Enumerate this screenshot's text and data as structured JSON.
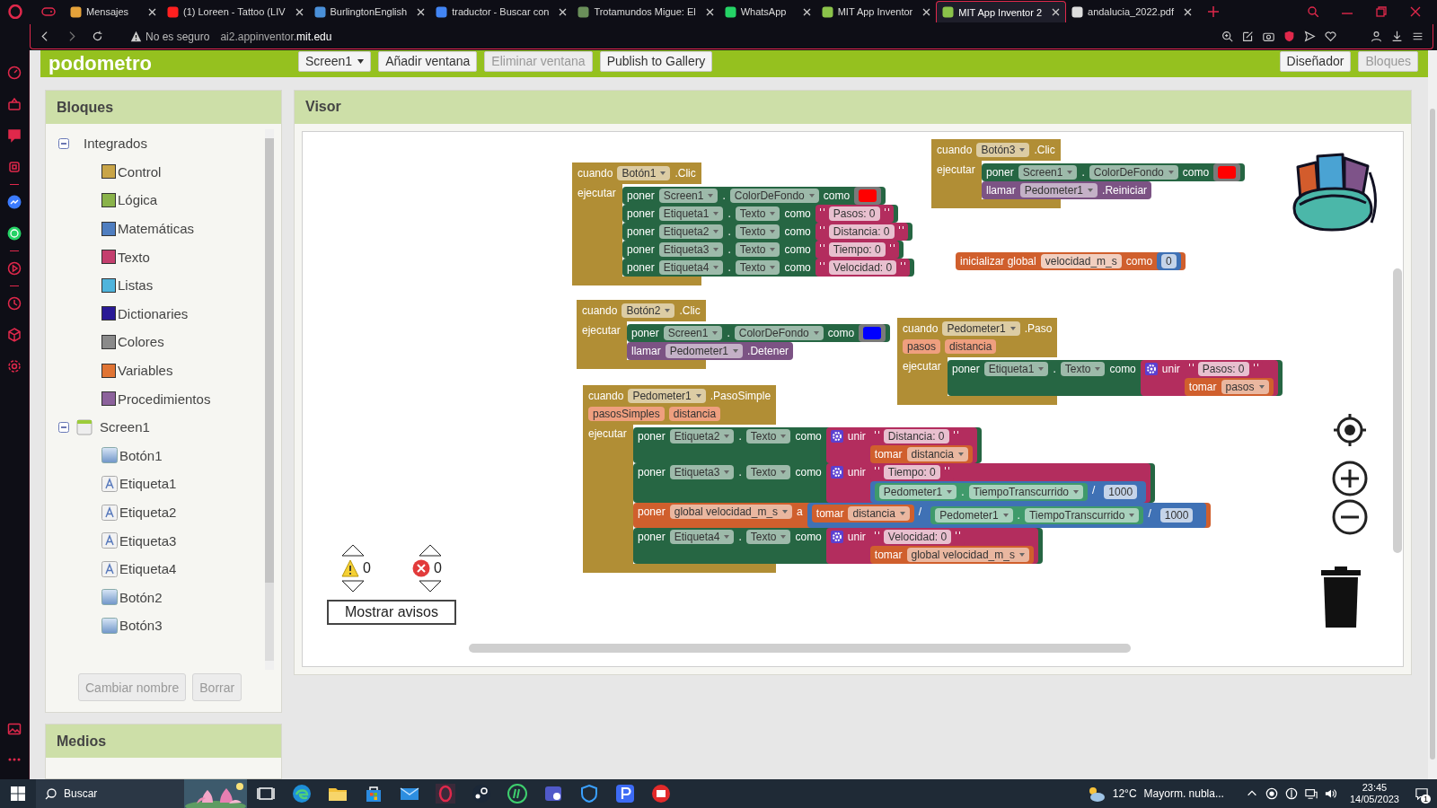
{
  "browser": {
    "tabs": [
      {
        "title": "Mensajes",
        "selected": false
      },
      {
        "title": "(1) Loreen - Tattoo (LIV",
        "selected": false
      },
      {
        "title": "BurlingtonEnglish",
        "selected": false
      },
      {
        "title": "traductor - Buscar con",
        "selected": false
      },
      {
        "title": "Trotamundos Migue: El",
        "selected": false
      },
      {
        "title": "WhatsApp",
        "selected": false
      },
      {
        "title": "MIT App Inventor",
        "selected": false
      },
      {
        "title": "MIT App Inventor 2",
        "selected": true
      },
      {
        "title": "andalucia_2022.pdf",
        "selected": false
      }
    ],
    "security": "No es seguro",
    "url": "ai2.appinventor.**mit.edu**"
  },
  "app": {
    "title": "podometro",
    "toolbar": [
      {
        "label": "Screen1",
        "kind": "dropdown",
        "disabled": false
      },
      {
        "label": "Añadir ventana",
        "kind": "button",
        "disabled": false
      },
      {
        "label": "Eliminar ventana",
        "kind": "button",
        "disabled": true
      },
      {
        "label": "Publish to Gallery",
        "kind": "button",
        "disabled": false
      }
    ],
    "views": [
      {
        "label": "Diseñador",
        "selected": false
      },
      {
        "label": "Bloques",
        "selected": true
      }
    ]
  },
  "blocks_panel": {
    "title": "Bloques",
    "tree": [
      {
        "label": "Integrados",
        "kind": "group",
        "expanded": true,
        "children": [
          {
            "label": "Control",
            "color": "#c9a548"
          },
          {
            "label": "Lógica",
            "color": "#8ab34a"
          },
          {
            "label": "Matemáticas",
            "color": "#4f7ec0"
          },
          {
            "label": "Texto",
            "color": "#c43f6e"
          },
          {
            "label": "Listas",
            "color": "#4fb4dc"
          },
          {
            "label": "Dictionaries",
            "color": "#2a1a96"
          },
          {
            "label": "Colores",
            "color": "#8a8a8a"
          },
          {
            "label": "Variables",
            "color": "#e07434"
          },
          {
            "label": "Procedimientos",
            "color": "#8c629c"
          }
        ]
      },
      {
        "label": "Screen1",
        "kind": "screen",
        "expanded": true,
        "children": [
          {
            "label": "Botón1",
            "kind": "button"
          },
          {
            "label": "Etiqueta1",
            "kind": "label"
          },
          {
            "label": "Etiqueta2",
            "kind": "label"
          },
          {
            "label": "Etiqueta3",
            "kind": "label"
          },
          {
            "label": "Etiqueta4",
            "kind": "label"
          },
          {
            "label": "Botón2",
            "kind": "button"
          },
          {
            "label": "Botón3",
            "kind": "button"
          }
        ]
      }
    ],
    "buttons": [
      {
        "label": "Cambiar nombre",
        "disabled": true
      },
      {
        "label": "Borrar",
        "disabled": true
      }
    ]
  },
  "media_panel": {
    "title": "Medios"
  },
  "viewer": {
    "title": "Visor",
    "warnings": "0",
    "errors": "0",
    "warnings_button": "Mostrar avisos",
    "blocks": [
      {
        "kind": "control",
        "rows": [
          [
            {
              "kind": "label",
              "text": "cuando"
            },
            {
              "kind": "dropdown",
              "text": "Botón1"
            },
            {
              "kind": "label",
              "text": ".Clic"
            }
          ],
          [
            {
              "kind": "label",
              "text": "ejecutar"
            },
            {
              "kind": "stack",
              "blocks": [
                {
                  "kind": "setter",
                  "rows": [
                    [
                      {
                        "kind": "label",
                        "text": "poner"
                      },
                      {
                        "kind": "dropdown",
                        "text": "Screen1"
                      },
                      {
                        "kind": "label",
                        "text": "."
                      },
                      {
                        "kind": "dropdown",
                        "text": "ColorDeFondo"
                      },
                      {
                        "kind": "label",
                        "text": "como"
                      },
                      {
                        "kind": "value",
                        "block": {
                          "kind": "color",
                          "rows": [
                            [
                              {
                                "kind": "swatch",
                                "color": "#ff0000"
                              }
                            ]
                          ]
                        }
                      }
                    ]
                  ]
                },
                {
                  "kind": "setter",
                  "rows": [
                    [
                      {
                        "kind": "label",
                        "text": "poner"
                      },
                      {
                        "kind": "dropdown",
                        "text": "Etiqueta1"
                      },
                      {
                        "kind": "label",
                        "text": "."
                      },
                      {
                        "kind": "dropdown",
                        "text": "Texto"
                      },
                      {
                        "kind": "label",
                        "text": "como"
                      },
                      {
                        "kind": "value",
                        "block": {
                          "kind": "text",
                          "rows": [
                            [
                              {
                                "kind": "quote",
                                "text": "Pasos: 0"
                              }
                            ]
                          ]
                        }
                      }
                    ]
                  ]
                },
                {
                  "kind": "setter",
                  "rows": [
                    [
                      {
                        "kind": "label",
                        "text": "poner"
                      },
                      {
                        "kind": "dropdown",
                        "text": "Etiqueta2"
                      },
                      {
                        "kind": "label",
                        "text": "."
                      },
                      {
                        "kind": "dropdown",
                        "text": "Texto"
                      },
                      {
                        "kind": "label",
                        "text": "como"
                      },
                      {
                        "kind": "value",
                        "block": {
                          "kind": "text",
                          "rows": [
                            [
                              {
                                "kind": "quote",
                                "text": "Distancia: 0"
                              }
                            ]
                          ]
                        }
                      }
                    ]
                  ]
                },
                {
                  "kind": "setter",
                  "rows": [
                    [
                      {
                        "kind": "label",
                        "text": "poner"
                      },
                      {
                        "kind": "dropdown",
                        "text": "Etiqueta3"
                      },
                      {
                        "kind": "label",
                        "text": "."
                      },
                      {
                        "kind": "dropdown",
                        "text": "Texto"
                      },
                      {
                        "kind": "label",
                        "text": "como"
                      },
                      {
                        "kind": "value",
                        "block": {
                          "kind": "text",
                          "rows": [
                            [
                              {
                                "kind": "quote",
                                "text": "Tiempo: 0"
                              }
                            ]
                          ]
                        }
                      }
                    ]
                  ]
                },
                {
                  "kind": "setter",
                  "rows": [
                    [
                      {
                        "kind": "label",
                        "text": "poner"
                      },
                      {
                        "kind": "dropdown",
                        "text": "Etiqueta4"
                      },
                      {
                        "kind": "label",
                        "text": "."
                      },
                      {
                        "kind": "dropdown",
                        "text": "Texto"
                      },
                      {
                        "kind": "label",
                        "text": "como"
                      },
                      {
                        "kind": "value",
                        "block": {
                          "kind": "text",
                          "rows": [
                            [
                              {
                                "kind": "quote",
                                "text": "Velocidad: 0"
                              }
                            ]
                          ]
                        }
                      }
                    ]
                  ]
                }
              ]
            }
          ]
        ]
      },
      {
        "kind": "control",
        "rows": [
          [
            {
              "kind": "label",
              "text": "cuando"
            },
            {
              "kind": "dropdown",
              "text": "Botón3"
            },
            {
              "kind": "label",
              "text": ".Clic"
            }
          ],
          [
            {
              "kind": "label",
              "text": "ejecutar"
            },
            {
              "kind": "stack",
              "blocks": [
                {
                  "kind": "setter",
                  "rows": [
                    [
                      {
                        "kind": "label",
                        "text": "poner"
                      },
                      {
                        "kind": "dropdown",
                        "text": "Screen1"
                      },
                      {
                        "kind": "label",
                        "text": "."
                      },
                      {
                        "kind": "dropdown",
                        "text": "ColorDeFondo"
                      },
                      {
                        "kind": "label",
                        "text": "como"
                      },
                      {
                        "kind": "value",
                        "block": {
                          "kind": "color",
                          "rows": [
                            [
                              {
                                "kind": "swatch",
                                "color": "#ff0000"
                              }
                            ]
                          ]
                        }
                      }
                    ]
                  ]
                },
                {
                  "kind": "call",
                  "rows": [
                    [
                      {
                        "kind": "label",
                        "text": "llamar"
                      },
                      {
                        "kind": "dropdown",
                        "text": "Pedometer1"
                      },
                      {
                        "kind": "label",
                        "text": ".Reiniciar"
                      }
                    ]
                  ]
                }
              ]
            }
          ]
        ]
      },
      {
        "kind": "variables",
        "rows": [
          [
            {
              "kind": "label",
              "text": "inicializar global"
            },
            {
              "kind": "field",
              "text": "velocidad_m_s"
            },
            {
              "kind": "label",
              "text": "como"
            },
            {
              "kind": "value",
              "block": {
                "kind": "math",
                "rows": [
                  [
                    {
                      "kind": "field",
                      "text": "0"
                    }
                  ]
                ]
              }
            }
          ]
        ]
      },
      {
        "kind": "control",
        "rows": [
          [
            {
              "kind": "label",
              "text": "cuando"
            },
            {
              "kind": "dropdown",
              "text": "Botón2"
            },
            {
              "kind": "label",
              "text": ".Clic"
            }
          ],
          [
            {
              "kind": "label",
              "text": "ejecutar"
            },
            {
              "kind": "stack",
              "blocks": [
                {
                  "kind": "setter",
                  "rows": [
                    [
                      {
                        "kind": "label",
                        "text": "poner"
                      },
                      {
                        "kind": "dropdown",
                        "text": "Screen1"
                      },
                      {
                        "kind": "label",
                        "text": "."
                      },
                      {
                        "kind": "dropdown",
                        "text": "ColorDeFondo"
                      },
                      {
                        "kind": "label",
                        "text": "como"
                      },
                      {
                        "kind": "value",
                        "block": {
                          "kind": "color",
                          "rows": [
                            [
                              {
                                "kind": "swatch",
                                "color": "#0000ff"
                              }
                            ]
                          ]
                        }
                      }
                    ]
                  ]
                },
                {
                  "kind": "call",
                  "rows": [
                    [
                      {
                        "kind": "label",
                        "text": "llamar"
                      },
                      {
                        "kind": "dropdown",
                        "text": "Pedometer1"
                      },
                      {
                        "kind": "label",
                        "text": ".Detener"
                      }
                    ]
                  ]
                }
              ]
            }
          ]
        ]
      },
      {
        "kind": "control",
        "rows": [
          [
            {
              "kind": "label",
              "text": "cuando"
            },
            {
              "kind": "dropdown",
              "text": "Pedometer1"
            },
            {
              "kind": "label",
              "text": ".Paso"
            }
          ],
          [
            {
              "kind": "param",
              "text": "pasos"
            },
            {
              "kind": "param",
              "text": "distancia"
            }
          ],
          [
            {
              "kind": "label",
              "text": "ejecutar"
            },
            {
              "kind": "stack",
              "blocks": [
                {
                  "kind": "setter",
                  "rows": [
                    [
                      {
                        "kind": "label",
                        "text": "poner"
                      },
                      {
                        "kind": "dropdown",
                        "text": "Etiqueta1"
                      },
                      {
                        "kind": "label",
                        "text": "."
                      },
                      {
                        "kind": "dropdown",
                        "text": "Texto"
                      },
                      {
                        "kind": "label",
                        "text": "como"
                      },
                      {
                        "kind": "value",
                        "block": {
                          "kind": "text",
                          "rows": [
                            [
                              {
                                "kind": "gear"
                              },
                              {
                                "kind": "label",
                                "text": "unir"
                              },
                              {
                                "kind": "stack",
                                "blocks": [
                                  {
                                    "kind": "text",
                                    "rows": [
                                      [
                                        {
                                          "kind": "quote",
                                          "text": "Pasos: 0"
                                        }
                                      ]
                                    ]
                                  },
                                  {
                                    "kind": "variables",
                                    "rows": [
                                      [
                                        {
                                          "kind": "label",
                                          "text": "tomar"
                                        },
                                        {
                                          "kind": "dropdown",
                                          "text": "pasos"
                                        }
                                      ]
                                    ]
                                  }
                                ]
                              }
                            ]
                          ]
                        }
                      }
                    ]
                  ]
                }
              ]
            }
          ]
        ]
      },
      {
        "kind": "control",
        "rows": [
          [
            {
              "kind": "label",
              "text": "cuando"
            },
            {
              "kind": "dropdown",
              "text": "Pedometer1"
            },
            {
              "kind": "label",
              "text": ".PasoSimple"
            }
          ],
          [
            {
              "kind": "param",
              "text": "pasosSimples"
            },
            {
              "kind": "param",
              "text": "distancia"
            }
          ],
          [
            {
              "kind": "label",
              "text": "ejecutar"
            },
            {
              "kind": "stack",
              "blocks": [
                {
                  "kind": "setter",
                  "rows": [
                    [
                      {
                        "kind": "label",
                        "text": "poner"
                      },
                      {
                        "kind": "dropdown",
                        "text": "Etiqueta2"
                      },
                      {
                        "kind": "label",
                        "text": "."
                      },
                      {
                        "kind": "dropdown",
                        "text": "Texto"
                      },
                      {
                        "kind": "label",
                        "text": "como"
                      },
                      {
                        "kind": "value",
                        "block": {
                          "kind": "text",
                          "rows": [
                            [
                              {
                                "kind": "gear"
                              },
                              {
                                "kind": "label",
                                "text": "unir"
                              },
                              {
                                "kind": "stack",
                                "blocks": [
                                  {
                                    "kind": "text",
                                    "rows": [
                                      [
                                        {
                                          "kind": "quote",
                                          "text": "Distancia: 0"
                                        }
                                      ]
                                    ]
                                  },
                                  {
                                    "kind": "variables",
                                    "rows": [
                                      [
                                        {
                                          "kind": "label",
                                          "text": "tomar"
                                        },
                                        {
                                          "kind": "dropdown",
                                          "text": "distancia"
                                        }
                                      ]
                                    ]
                                  }
                                ]
                              }
                            ]
                          ]
                        }
                      }
                    ]
                  ]
                },
                {
                  "kind": "setter",
                  "rows": [
                    [
                      {
                        "kind": "label",
                        "text": "poner"
                      },
                      {
                        "kind": "dropdown",
                        "text": "Etiqueta3"
                      },
                      {
                        "kind": "label",
                        "text": "."
                      },
                      {
                        "kind": "dropdown",
                        "text": "Texto"
                      },
                      {
                        "kind": "label",
                        "text": "como"
                      },
                      {
                        "kind": "value",
                        "block": {
                          "kind": "text",
                          "rows": [
                            [
                              {
                                "kind": "gear"
                              },
                              {
                                "kind": "label",
                                "text": "unir"
                              },
                              {
                                "kind": "stack",
                                "blocks": [
                                  {
                                    "kind": "text",
                                    "rows": [
                                      [
                                        {
                                          "kind": "quote",
                                          "text": "Tiempo: 0"
                                        }
                                      ]
                                    ]
                                  },
                                  {
                                    "kind": "math",
                                    "rows": [
                                      [
                                        {
                                          "kind": "value",
                                          "block": {
                                            "kind": "getter",
                                            "rows": [
                                              [
                                                {
                                                  "kind": "dropdown",
                                                  "text": "Pedometer1"
                                                },
                                                {
                                                  "kind": "label",
                                                  "text": "."
                                                },
                                                {
                                                  "kind": "dropdown",
                                                  "text": "TiempoTranscurrido"
                                                }
                                              ]
                                            ]
                                          }
                                        },
                                        {
                                          "kind": "label",
                                          "text": "/"
                                        },
                                        {
                                          "kind": "value",
                                          "block": {
                                            "kind": "math",
                                            "rows": [
                                              [
                                                {
                                                  "kind": "field",
                                                  "text": "1000"
                                                }
                                              ]
                                            ]
                                          }
                                        }
                                      ]
                                    ]
                                  }
                                ]
                              }
                            ]
                          ]
                        }
                      }
                    ]
                  ]
                },
                {
                  "kind": "variables",
                  "rows": [
                    [
                      {
                        "kind": "label",
                        "text": "poner"
                      },
                      {
                        "kind": "dropdown",
                        "text": "global velocidad_m_s"
                      },
                      {
                        "kind": "label",
                        "text": "a"
                      },
                      {
                        "kind": "value",
                        "block": {
                          "kind": "math",
                          "rows": [
                            [
                              {
                                "kind": "value",
                                "block": {
                                  "kind": "variables",
                                  "rows": [
                                    [
                                      {
                                        "kind": "label",
                                        "text": "tomar"
                                      },
                                      {
                                        "kind": "dropdown",
                                        "text": "distancia"
                                      }
                                    ]
                                  ]
                                }
                              },
                              {
                                "kind": "label",
                                "text": "/"
                              },
                              {
                                "kind": "value",
                                "block": {
                                  "kind": "math",
                                  "rows": [
                                    [
                                      {
                                        "kind": "value",
                                        "block": {
                                          "kind": "getter",
                                          "rows": [
                                            [
                                              {
                                                "kind": "dropdown",
                                                "text": "Pedometer1"
                                              },
                                              {
                                                "kind": "label",
                                                "text": "."
                                              },
                                              {
                                                "kind": "dropdown",
                                                "text": "TiempoTranscurrido"
                                              }
                                            ]
                                          ]
                                        }
                                      },
                                      {
                                        "kind": "label",
                                        "text": "/"
                                      },
                                      {
                                        "kind": "value",
                                        "block": {
                                          "kind": "math",
                                          "rows": [
                                            [
                                              {
                                                "kind": "field",
                                                "text": "1000"
                                              }
                                            ]
                                          ]
                                        }
                                      }
                                    ]
                                  ]
                                }
                              }
                            ]
                          ]
                        }
                      }
                    ]
                  ]
                },
                {
                  "kind": "setter",
                  "rows": [
                    [
                      {
                        "kind": "label",
                        "text": "poner"
                      },
                      {
                        "kind": "dropdown",
                        "text": "Etiqueta4"
                      },
                      {
                        "kind": "label",
                        "text": "."
                      },
                      {
                        "kind": "dropdown",
                        "text": "Texto"
                      },
                      {
                        "kind": "label",
                        "text": "como"
                      },
                      {
                        "kind": "value",
                        "block": {
                          "kind": "text",
                          "rows": [
                            [
                              {
                                "kind": "gear"
                              },
                              {
                                "kind": "label",
                                "text": "unir"
                              },
                              {
                                "kind": "stack",
                                "blocks": [
                                  {
                                    "kind": "text",
                                    "rows": [
                                      [
                                        {
                                          "kind": "quote",
                                          "text": "Velocidad: 0"
                                        }
                                      ]
                                    ]
                                  },
                                  {
                                    "kind": "variables",
                                    "rows": [
                                      [
                                        {
                                          "kind": "label",
                                          "text": "tomar"
                                        },
                                        {
                                          "kind": "dropdown",
                                          "text": "global velocidad_m_s"
                                        }
                                      ]
                                    ]
                                  }
                                ]
                              }
                            ]
                          ]
                        }
                      }
                    ]
                  ]
                }
              ]
            }
          ]
        ]
      }
    ]
  },
  "taskbar": {
    "search": {
      "placeholder": "Buscar"
    },
    "temperature": "12°C",
    "weather": "Mayorm. nubla...",
    "time": "23:45",
    "date": "14/05/2023",
    "notifications": "1"
  }
}
